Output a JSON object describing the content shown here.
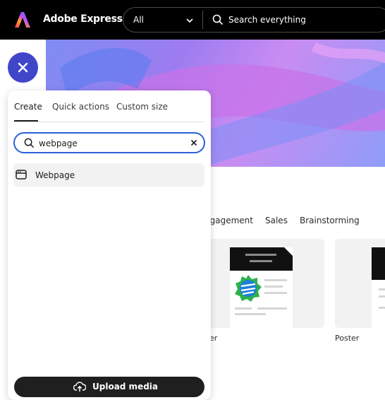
{
  "app": {
    "title": "Adobe Express"
  },
  "header": {
    "filter_value": "All",
    "search_placeholder": "Search everything"
  },
  "categories": [
    "ngagement",
    "Sales",
    "Brainstorming"
  ],
  "templates": [
    {
      "label": "er"
    },
    {
      "label": "Poster"
    }
  ],
  "panel": {
    "tabs": [
      {
        "label": "Create",
        "active": true
      },
      {
        "label": "Quick actions",
        "active": false
      },
      {
        "label": "Custom size",
        "active": false
      }
    ],
    "search": {
      "value": "webpage"
    },
    "results": [
      {
        "label": "Webpage",
        "icon": "webpage-icon"
      }
    ],
    "upload_label": "Upload media"
  },
  "colors": {
    "topbar": "#000000",
    "close_button": "#4046ca",
    "search_focus": "#2a60d8",
    "upload_button": "#1f1f1f"
  }
}
